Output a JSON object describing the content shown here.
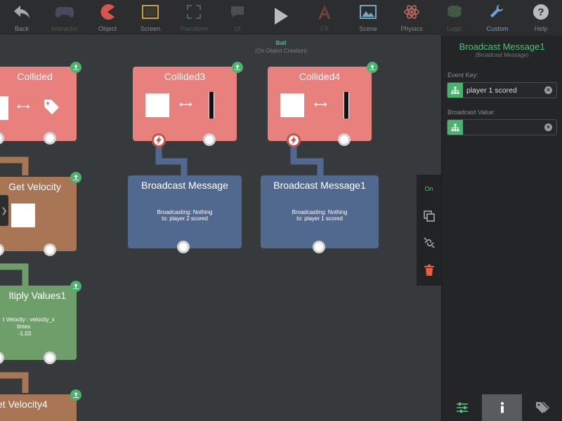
{
  "toolbar": {
    "items": [
      {
        "label": "Back",
        "icon": "back-arrow-icon"
      },
      {
        "label": "Interactor",
        "icon": "gamepad-icon"
      },
      {
        "label": "Object",
        "icon": "pacman-icon"
      },
      {
        "label": "Screen",
        "icon": "screen-frame-icon"
      },
      {
        "label": "Transform",
        "icon": "expand-arrows-icon"
      },
      {
        "label": "UI",
        "icon": "speech-bubble-icon"
      },
      {
        "label": "",
        "icon": "play-icon"
      },
      {
        "label": "FX",
        "icon": "fx-icon"
      },
      {
        "label": "Scene",
        "icon": "landscape-icon"
      },
      {
        "label": "Physics",
        "icon": "atom-icon"
      },
      {
        "label": "Logic",
        "icon": "brain-icon"
      },
      {
        "label": "Custom",
        "icon": "wrench-icon"
      },
      {
        "label": "Help",
        "icon": "help-icon"
      }
    ]
  },
  "canvas": {
    "scene_name": "Ball",
    "scene_sub": "(On Object Creation)",
    "blocks": {
      "collided": {
        "title": "Collided"
      },
      "collided3": {
        "title": "Collided3"
      },
      "collided4": {
        "title": "Collided4"
      },
      "get_velocity": {
        "title": "Get Velocity"
      },
      "broadcast": {
        "title": "Broadcast Message",
        "line1": "Broadcasting: Nothing",
        "line2": "to: player 2 scored"
      },
      "broadcast1": {
        "title": "Broadcast Message1",
        "line1": "Broadcasting: Nothing",
        "line2": "to: player 1 scored"
      },
      "multiply": {
        "title": "ltiply Values1",
        "line1": "t Velocity : velocity_x",
        "line2": "times",
        "line3": "-1.03"
      },
      "set_velocity4": {
        "title": "et Velocity4"
      }
    }
  },
  "float_bar": {
    "on_label": "On"
  },
  "panel": {
    "title": "Broadcast Message1",
    "subtitle": "(Broadcast Message)",
    "event_key_label": "Event Key:",
    "event_key_value": "player 1 scored",
    "broadcast_value_label": "Broadcast Value:",
    "broadcast_value_value": ""
  },
  "colors": {
    "red_block": "#e8807e",
    "brown_block": "#a87555",
    "green_block": "#6e9f6b",
    "blue_block": "#52698f",
    "accent_green": "#4fc27a",
    "custom_blue": "#6fa0d6"
  }
}
